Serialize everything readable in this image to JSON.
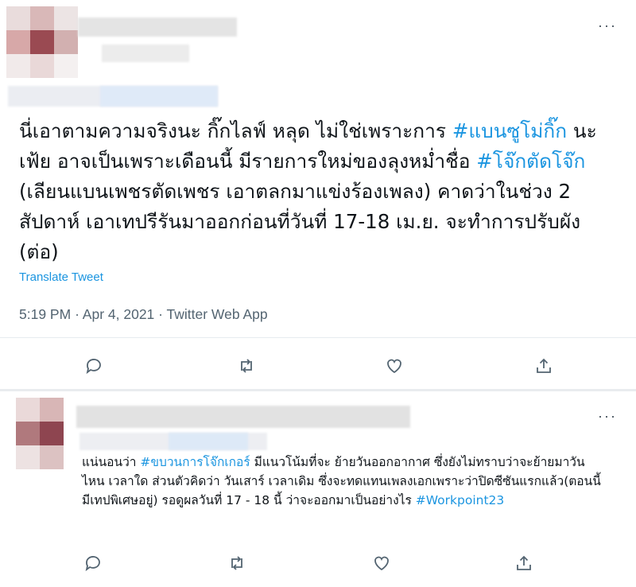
{
  "tweet1": {
    "segments": [
      {
        "text": "นี่เอาตามความจริงนะ กิ๊กไลฟ์ หลุด ไม่ใช่เพราะการ ",
        "link": false
      },
      {
        "text": "#แบนซูโม่กิ๊ก",
        "link": true
      },
      {
        "text": " นะเฟ้ย อาจเป็นเพราะเดือนนี้ มีรายการใหม่ของลุงหม่ำชื่อ ",
        "link": false
      },
      {
        "text": "#โจ๊กตัดโจ๊ก",
        "link": true
      },
      {
        "text": " (เลียนแบนเพชรตัดเพชร เอาตลกมาแข่งร้องเพลง) คาดว่าในช่วง 2 สัปดาห์ เอาเทปรีรันมาออกก่อนที่วันที่ 17-18 เม.ย. จะทำการปรับผัง (ต่อ)",
        "link": false
      }
    ],
    "translate": "Translate Tweet",
    "time": "5:19 PM",
    "date": "Apr 4, 2021",
    "source": "Twitter Web App",
    "separator": "·",
    "more": "···"
  },
  "tweet2": {
    "segments": [
      {
        "text": "แน่นอนว่า ",
        "link": false
      },
      {
        "text": "#ขบวนการโจ๊กเกอร์",
        "link": true
      },
      {
        "text": " มีแนวโน้มที่จะ ย้ายวันออกอากาศ ซึ่งยังไม่ทราบว่าจะย้ายมาวันไหน เวลาใด ส่วนตัวคิดว่า วันเสาร์ เวลาเดิม ซึ่งจะทดแทนเพลงเอกเพราะว่าปิดซีซันแรกแล้ว(ตอนนี้มีเทปพิเศษอยู่) รอดูผลวันที่ 17 - 18 นี้ ว่าจะออกมาเป็นอย่างไร ",
        "link": false
      },
      {
        "text": "#Workpoint23",
        "link": true
      }
    ],
    "more": "···"
  },
  "icons": [
    "reply-icon",
    "retweet-icon",
    "like-icon",
    "share-icon"
  ]
}
